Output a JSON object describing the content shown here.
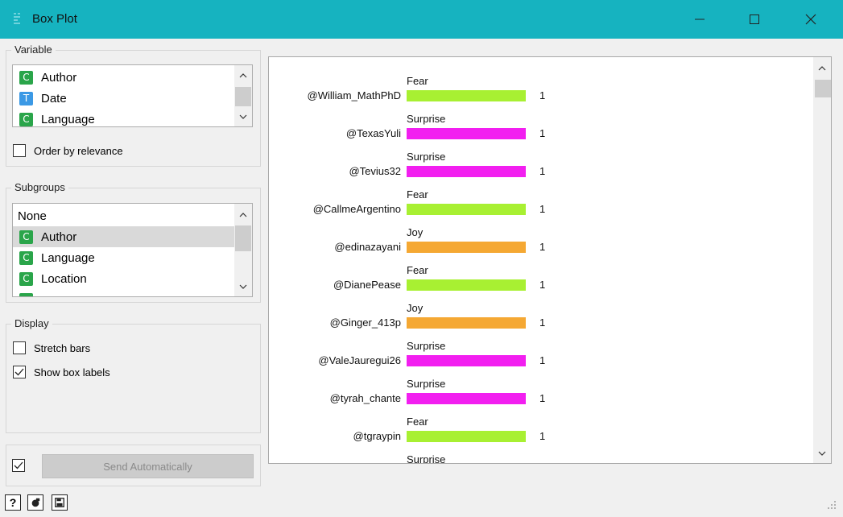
{
  "window": {
    "title": "Box Plot",
    "colors": {
      "titlebar": "#16b3c0"
    }
  },
  "variable": {
    "title": "Variable",
    "items": [
      {
        "badge": "C",
        "label": "Author"
      },
      {
        "badge": "T",
        "label": "Date"
      },
      {
        "badge": "C",
        "label": "Language"
      }
    ],
    "order_by_relevance": {
      "label": "Order by relevance",
      "checked": false
    }
  },
  "subgroups": {
    "title": "Subgroups",
    "items": [
      {
        "badge": "",
        "label": "None"
      },
      {
        "badge": "C",
        "label": "Author",
        "selected": true
      },
      {
        "badge": "C",
        "label": "Language"
      },
      {
        "badge": "C",
        "label": "Location"
      }
    ]
  },
  "display": {
    "title": "Display",
    "stretch_bars": {
      "label": "Stretch bars",
      "checked": false
    },
    "show_box_labels": {
      "label": "Show box labels",
      "checked": true
    }
  },
  "send": {
    "label": "Send Automatically",
    "checked": true
  },
  "chart_data": {
    "type": "bar",
    "orientation": "horizontal",
    "categories": [
      "@William_MathPhD",
      "@TexasYuli",
      "@Tevius32",
      "@CallmeArgentino",
      "@edinazayani",
      "@DianePease",
      "@Ginger_413p",
      "@ValeJauregui26",
      "@tyrah_chante",
      "@tgraypin"
    ],
    "labels": [
      "Fear",
      "Surprise",
      "Surprise",
      "Fear",
      "Joy",
      "Fear",
      "Joy",
      "Surprise",
      "Surprise",
      "Fear"
    ],
    "values": [
      1,
      1,
      1,
      1,
      1,
      1,
      1,
      1,
      1,
      1
    ],
    "partial_next_label": "Surprise",
    "colors": {
      "Fear": "#a8f032",
      "Surprise": "#f21ff0",
      "Joy": "#f5a833"
    }
  }
}
